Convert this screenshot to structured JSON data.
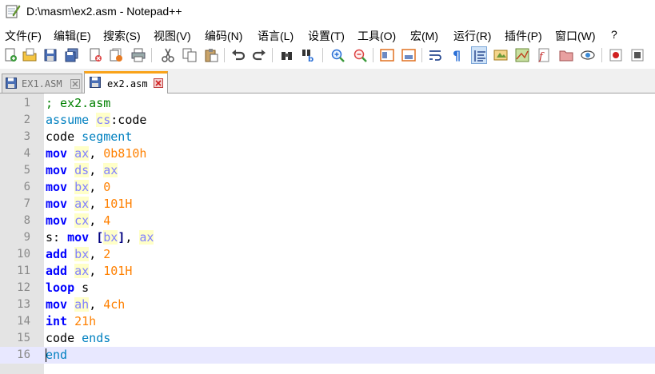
{
  "window": {
    "title": "D:\\masm\\ex2.asm - Notepad++"
  },
  "menu": {
    "items": [
      "文件(F)",
      "编辑(E)",
      "搜索(S)",
      "视图(V)",
      "编码(N)",
      "语言(L)",
      "设置(T)",
      "工具(O)",
      "宏(M)",
      "运行(R)",
      "插件(P)",
      "窗口(W)",
      "?"
    ]
  },
  "toolbar": {
    "buttons": [
      "new-file-icon",
      "open-file-icon",
      "save-icon",
      "save-all-icon",
      "close-icon",
      "close-all-icon",
      "print-icon",
      "cut-icon",
      "copy-icon",
      "paste-icon",
      "undo-icon",
      "redo-icon",
      "find-icon",
      "replace-icon",
      "zoom-in-icon",
      "zoom-out-icon",
      "sync-vertical-icon",
      "sync-horizontal-icon",
      "word-wrap-icon",
      "show-all-chars-icon",
      "indent-guide-icon",
      "user-language-icon",
      "document-map-icon",
      "function-list-icon",
      "folder-as-workspace-icon",
      "monitoring-icon",
      "record-macro-icon",
      "stop-macro-icon"
    ]
  },
  "tabs": [
    {
      "label": "EX1.ASM",
      "active": false
    },
    {
      "label": "ex2.asm",
      "active": true
    }
  ],
  "editor": {
    "current_line": 16,
    "lines": [
      {
        "no": "1",
        "tokens": [
          {
            "t": "; ex2.asm",
            "k": "comment"
          }
        ]
      },
      {
        "no": "2",
        "tokens": [
          {
            "t": "assume ",
            "k": "directive"
          },
          {
            "t": "cs",
            "k": "reg"
          },
          {
            "t": ":code",
            "k": "plain"
          }
        ]
      },
      {
        "no": "3",
        "tokens": [
          {
            "t": "code ",
            "k": "plain"
          },
          {
            "t": "segment",
            "k": "directive"
          }
        ]
      },
      {
        "no": "4",
        "tokens": [
          {
            "t": "mov",
            "k": "ins"
          },
          {
            "t": " ",
            "k": "plain"
          },
          {
            "t": "ax",
            "k": "reg"
          },
          {
            "t": ", ",
            "k": "plain"
          },
          {
            "t": "0b810h",
            "k": "num"
          }
        ]
      },
      {
        "no": "5",
        "tokens": [
          {
            "t": "mov",
            "k": "ins"
          },
          {
            "t": " ",
            "k": "plain"
          },
          {
            "t": "ds",
            "k": "reg"
          },
          {
            "t": ", ",
            "k": "plain"
          },
          {
            "t": "ax",
            "k": "reg"
          }
        ]
      },
      {
        "no": "6",
        "tokens": [
          {
            "t": "mov",
            "k": "ins"
          },
          {
            "t": " ",
            "k": "plain"
          },
          {
            "t": "bx",
            "k": "reg"
          },
          {
            "t": ", ",
            "k": "plain"
          },
          {
            "t": "0",
            "k": "num"
          }
        ]
      },
      {
        "no": "7",
        "tokens": [
          {
            "t": "mov",
            "k": "ins"
          },
          {
            "t": " ",
            "k": "plain"
          },
          {
            "t": "ax",
            "k": "reg"
          },
          {
            "t": ", ",
            "k": "plain"
          },
          {
            "t": "101H",
            "k": "num"
          }
        ]
      },
      {
        "no": "8",
        "tokens": [
          {
            "t": "mov",
            "k": "ins"
          },
          {
            "t": " ",
            "k": "plain"
          },
          {
            "t": "cx",
            "k": "reg"
          },
          {
            "t": ", ",
            "k": "plain"
          },
          {
            "t": "4",
            "k": "num"
          }
        ]
      },
      {
        "no": "9",
        "tokens": [
          {
            "t": "s: ",
            "k": "plain"
          },
          {
            "t": "mov",
            "k": "ins"
          },
          {
            "t": " ",
            "k": "plain"
          },
          {
            "t": "[",
            "k": "op"
          },
          {
            "t": "bx",
            "k": "reg"
          },
          {
            "t": "]",
            "k": "op"
          },
          {
            "t": ", ",
            "k": "plain"
          },
          {
            "t": "ax",
            "k": "reg"
          }
        ]
      },
      {
        "no": "10",
        "tokens": [
          {
            "t": "add",
            "k": "ins"
          },
          {
            "t": " ",
            "k": "plain"
          },
          {
            "t": "bx",
            "k": "reg"
          },
          {
            "t": ", ",
            "k": "plain"
          },
          {
            "t": "2",
            "k": "num"
          }
        ]
      },
      {
        "no": "11",
        "tokens": [
          {
            "t": "add",
            "k": "ins"
          },
          {
            "t": " ",
            "k": "plain"
          },
          {
            "t": "ax",
            "k": "reg"
          },
          {
            "t": ", ",
            "k": "plain"
          },
          {
            "t": "101H",
            "k": "num"
          }
        ]
      },
      {
        "no": "12",
        "tokens": [
          {
            "t": "loop",
            "k": "ins"
          },
          {
            "t": " s",
            "k": "plain"
          }
        ]
      },
      {
        "no": "13",
        "tokens": [
          {
            "t": "mov",
            "k": "ins"
          },
          {
            "t": " ",
            "k": "plain"
          },
          {
            "t": "ah",
            "k": "reg"
          },
          {
            "t": ", ",
            "k": "plain"
          },
          {
            "t": "4ch",
            "k": "num"
          }
        ]
      },
      {
        "no": "14",
        "tokens": [
          {
            "t": "int",
            "k": "ins"
          },
          {
            "t": " ",
            "k": "plain"
          },
          {
            "t": "21h",
            "k": "num"
          }
        ]
      },
      {
        "no": "15",
        "tokens": [
          {
            "t": "code ",
            "k": "plain"
          },
          {
            "t": "ends",
            "k": "directive"
          }
        ]
      },
      {
        "no": "16",
        "tokens": [
          {
            "t": "end",
            "k": "directive"
          }
        ]
      }
    ]
  },
  "colors": {
    "tab_active_accent": "#f9a31a",
    "current_line_bg": "#e8e8ff",
    "gutter_bg": "#e4e4e4"
  }
}
